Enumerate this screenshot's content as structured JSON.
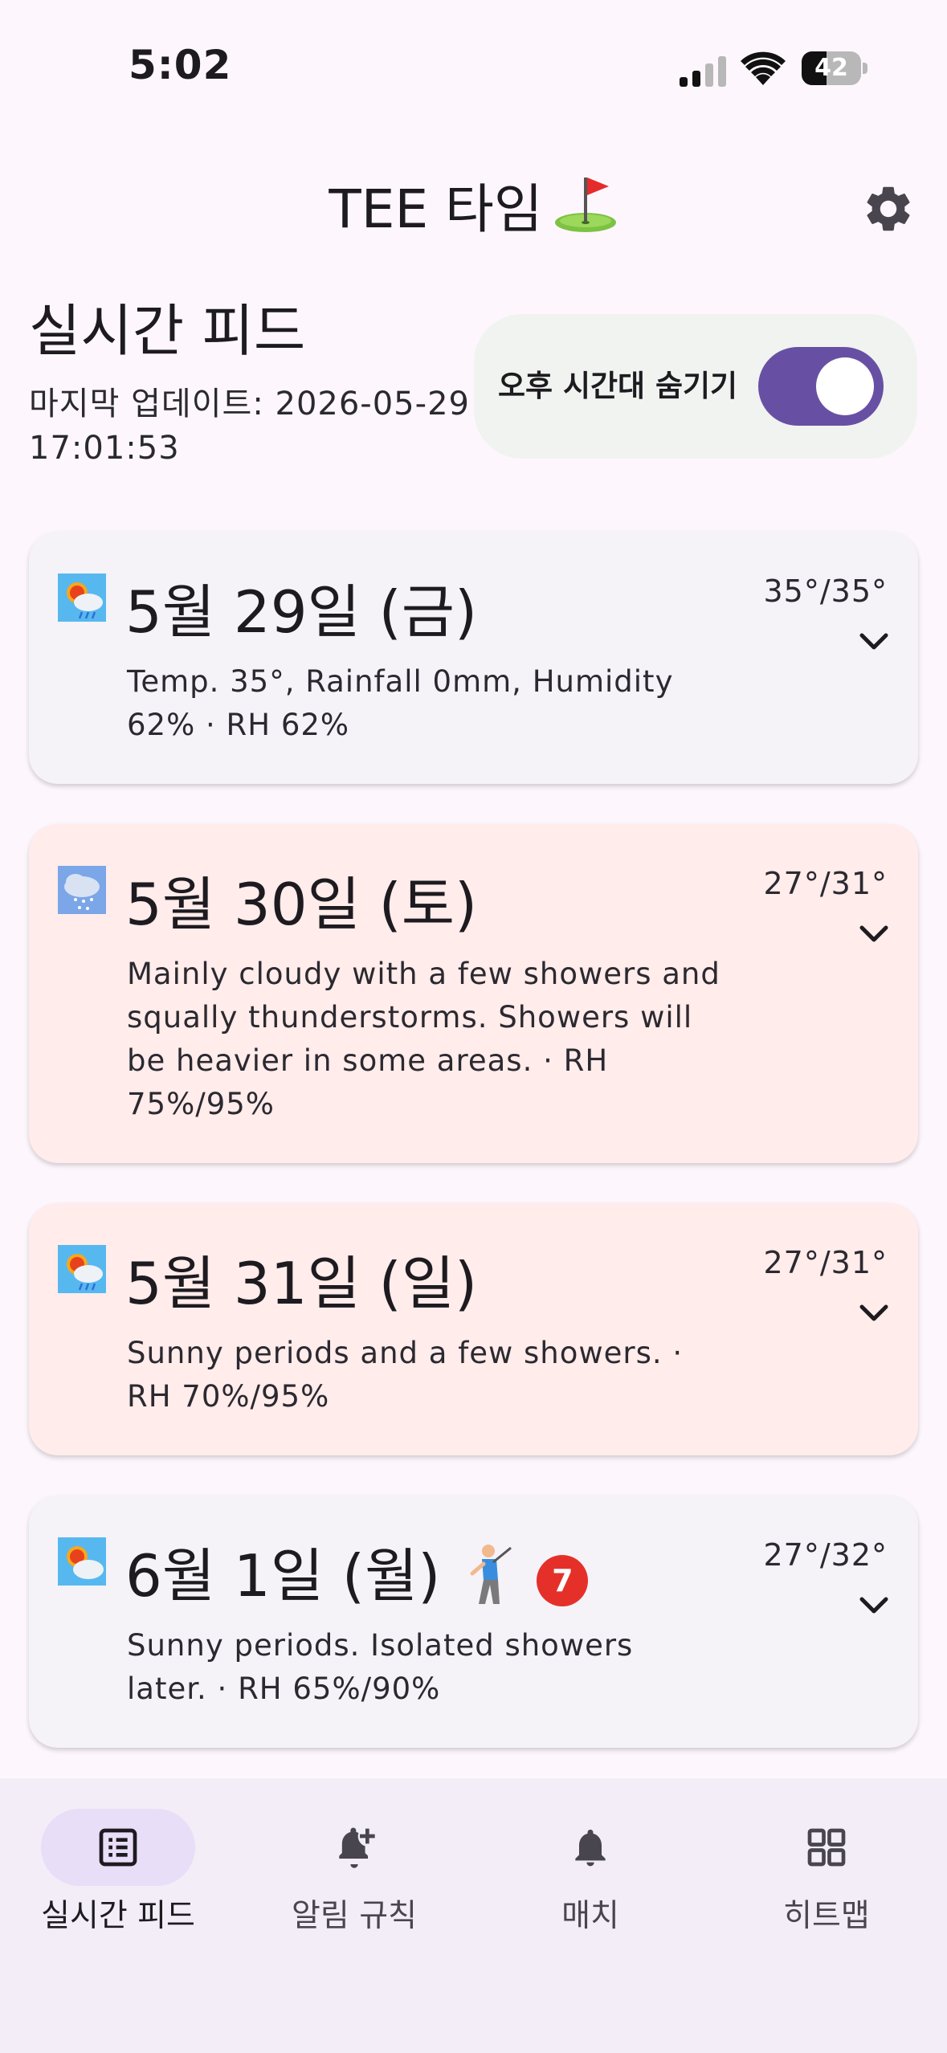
{
  "status_bar": {
    "time": "5:02",
    "battery_level": "42",
    "battery_percent": 42
  },
  "header": {
    "title": "TEE 타임",
    "title_icon": "golf-flag-icon",
    "settings_icon": "gear-icon"
  },
  "feed": {
    "title": "실시간 피드",
    "last_updated": "마지막 업데이트: 2026-05-29 17:01:53",
    "hide_afternoon_label": "오후 시간대 숨기기",
    "hide_afternoon_on": true
  },
  "cards": [
    {
      "date": "5월 29일 (금)",
      "temp": "35°/35°",
      "desc": "Temp. 35°, Rainfall 0mm, Humidity 62% · RH 62%",
      "icon": "sun-cloud-rain-icon",
      "highlight": false
    },
    {
      "date": "5월 30일 (토)",
      "temp": "27°/31°",
      "desc": "Mainly cloudy with a few showers and squally thunderstorms. Showers will be heavier in some areas. · RH 75%/95%",
      "icon": "cloud-rain-icon",
      "highlight": true
    },
    {
      "date": "5월 31일 (일)",
      "temp": "27°/31°",
      "desc": "Sunny periods and a few showers. · RH 70%/95%",
      "icon": "sun-cloud-rain-icon",
      "highlight": true
    },
    {
      "date": "6월 1일 (월)",
      "temp": "27°/32°",
      "desc": "Sunny periods. Isolated showers later. · RH 65%/90%",
      "icon": "sun-cloud-icon",
      "highlight": false,
      "badge": "7",
      "golfer_icon": "golfer-icon"
    }
  ],
  "nav": {
    "items": [
      {
        "label": "실시간 피드",
        "icon": "list-icon",
        "active": true
      },
      {
        "label": "알림 규칙",
        "icon": "bell-plus-icon",
        "active": false
      },
      {
        "label": "매치",
        "icon": "bell-icon",
        "active": false
      },
      {
        "label": "히트맵",
        "icon": "grid-icon",
        "active": false
      }
    ]
  },
  "colors": {
    "accent": "#6750a4",
    "alert_card": "#ffeceb",
    "neutral_card": "#f5f3f8",
    "badge": "#e5302a"
  }
}
